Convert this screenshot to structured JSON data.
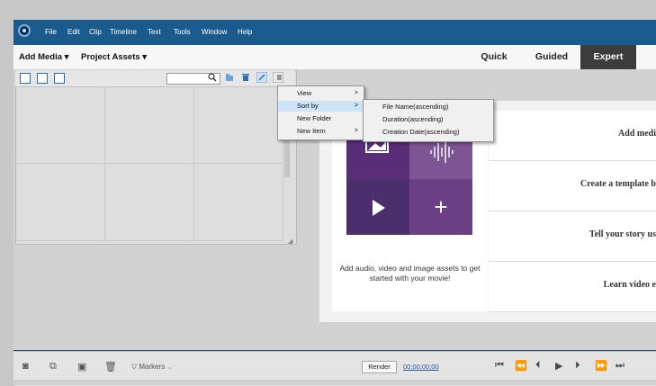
{
  "menu": [
    "File",
    "Edit",
    "Clip",
    "Timeline",
    "Text",
    "Tools",
    "Window",
    "Help"
  ],
  "toolbar": {
    "add_media": "Add Media ▾",
    "project_assets": "Project Assets ▾",
    "modes": [
      "Quick",
      "Guided",
      "Expert"
    ],
    "active_mode": "Expert"
  },
  "context_menu": {
    "items": [
      {
        "label": "View",
        "arrow": ">"
      },
      {
        "label": "Sort by",
        "arrow": ">"
      },
      {
        "label": "New Folder",
        "arrow": ""
      },
      {
        "label": "New Item",
        "arrow": ">"
      }
    ],
    "submenu": [
      "File Name(ascending)",
      "Duration(ascending)",
      "Creation Date(ascending)"
    ]
  },
  "welcome": {
    "card_text": "Add audio, video and image assets to get started with your movie!",
    "list": [
      "Add medi",
      "Create a template b",
      "Tell your story us",
      "Learn video e"
    ]
  },
  "bottom": {
    "markers": "Markers",
    "render": "Render",
    "timecode": "00;00;00;00"
  },
  "icons": {
    "plus": "+"
  },
  "colors": {
    "title_bar": "#1b5a8c",
    "active_mode": "#3c3c3c",
    "tile_purple": "#6b3f86",
    "menu_highlight": "#cde3f7"
  }
}
